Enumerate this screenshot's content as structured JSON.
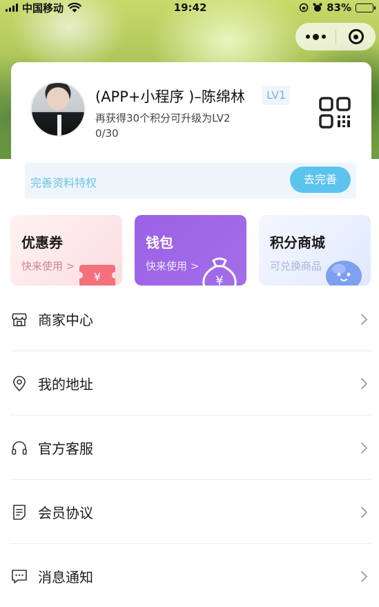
{
  "status_bar": {
    "carrier": "中国移动",
    "time": "19:42",
    "battery": "83%"
  },
  "capsule": {
    "more_icon": "more-dots-icon",
    "close_icon": "close-target-icon"
  },
  "profile": {
    "name": "(APP+小程序 )–陈绵林",
    "level": "LV1",
    "upgrade_hint": "再获得30个积分可升级为LV2",
    "points_progress": "0/30",
    "qr_icon": "qr-code-icon"
  },
  "perk": {
    "label": "完善资料特权",
    "button": "去完善"
  },
  "features": [
    {
      "title": "优惠券",
      "subtitle": "快来使用 >"
    },
    {
      "title": "钱包",
      "subtitle": "快来使用 >"
    },
    {
      "title": "积分商城",
      "subtitle": "可兑换商品"
    }
  ],
  "menu": [
    {
      "label": "商家中心",
      "icon": "store-icon"
    },
    {
      "label": "我的地址",
      "icon": "location-pin-icon"
    },
    {
      "label": "官方客服",
      "icon": "headset-icon"
    },
    {
      "label": "会员协议",
      "icon": "document-icon"
    },
    {
      "label": "消息通知",
      "icon": "message-icon"
    }
  ],
  "colors": {
    "accent": "#5cc3ef",
    "perk_bg": "#eef6fb",
    "wallet": "#9b62e6"
  }
}
